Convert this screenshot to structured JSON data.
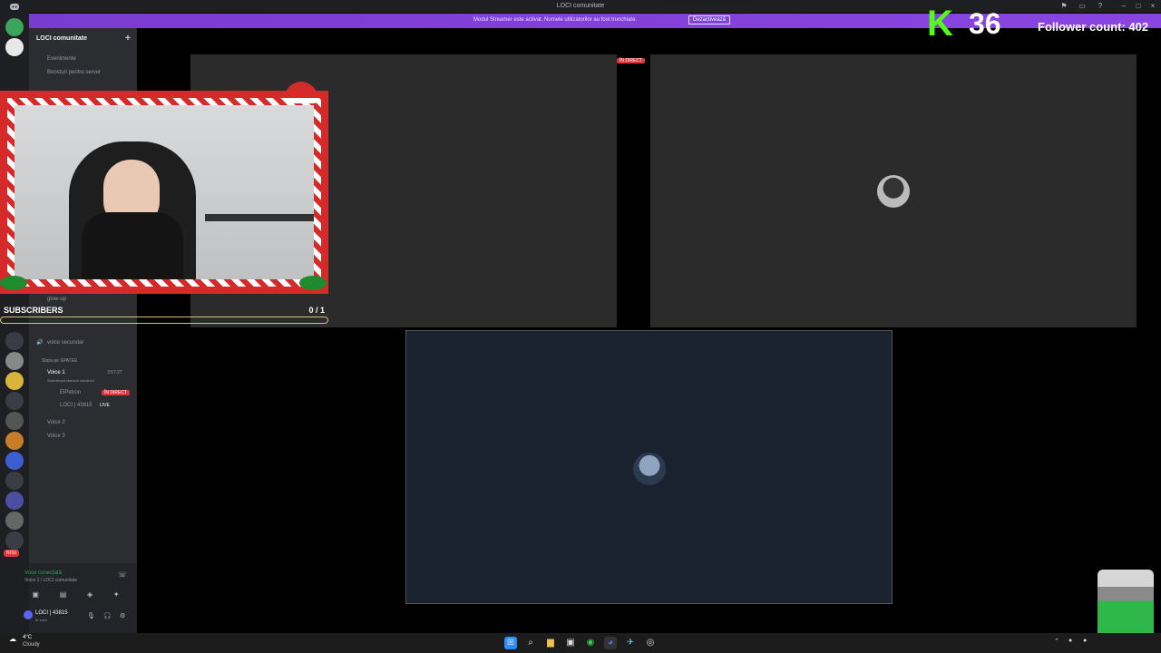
{
  "window": {
    "title": "LOCI comunitate"
  },
  "banner": {
    "text": "Modul Streamer este activat. Numele utilizatorilor au fost trunchiate.",
    "button": "Dezactivează"
  },
  "sidebar": {
    "server_name": "LOCI comunitate",
    "items": {
      "events": "Evenimente",
      "boosts": "Boosturi pentru server",
      "voice_secondary": "voice secundar",
      "category": "Stara pe SPATEE",
      "voice1": "Voice 1",
      "voice1_time": "3:57:27",
      "voice1_sub": "Selectează statusul canalului",
      "user1": "ElPetron",
      "user1_badge": "ÎN DIRECT",
      "user2": "LOCI | 43815",
      "user2_badge": "LIVE",
      "voice2": "Voice 2",
      "voice3": "Voice 3",
      "glow": "glow-up",
      "new_badge": "NOU"
    },
    "voice_status": {
      "title": "Voce conectată",
      "sub": "Voice 1 / LOCI comunitate"
    },
    "user": {
      "name": "LOCI | 43815",
      "status": "În voce"
    }
  },
  "stream": {
    "badge": "ÎN DIRECT"
  },
  "overlay": {
    "subs_label": "SUBSCRIBERS",
    "subs_count": "0  / 1",
    "kick_logo": "K",
    "kick_count": "36",
    "follower": "Follower count: 402"
  },
  "taskbar": {
    "weather_temp": "4°C",
    "weather_text": "Cloudy"
  }
}
